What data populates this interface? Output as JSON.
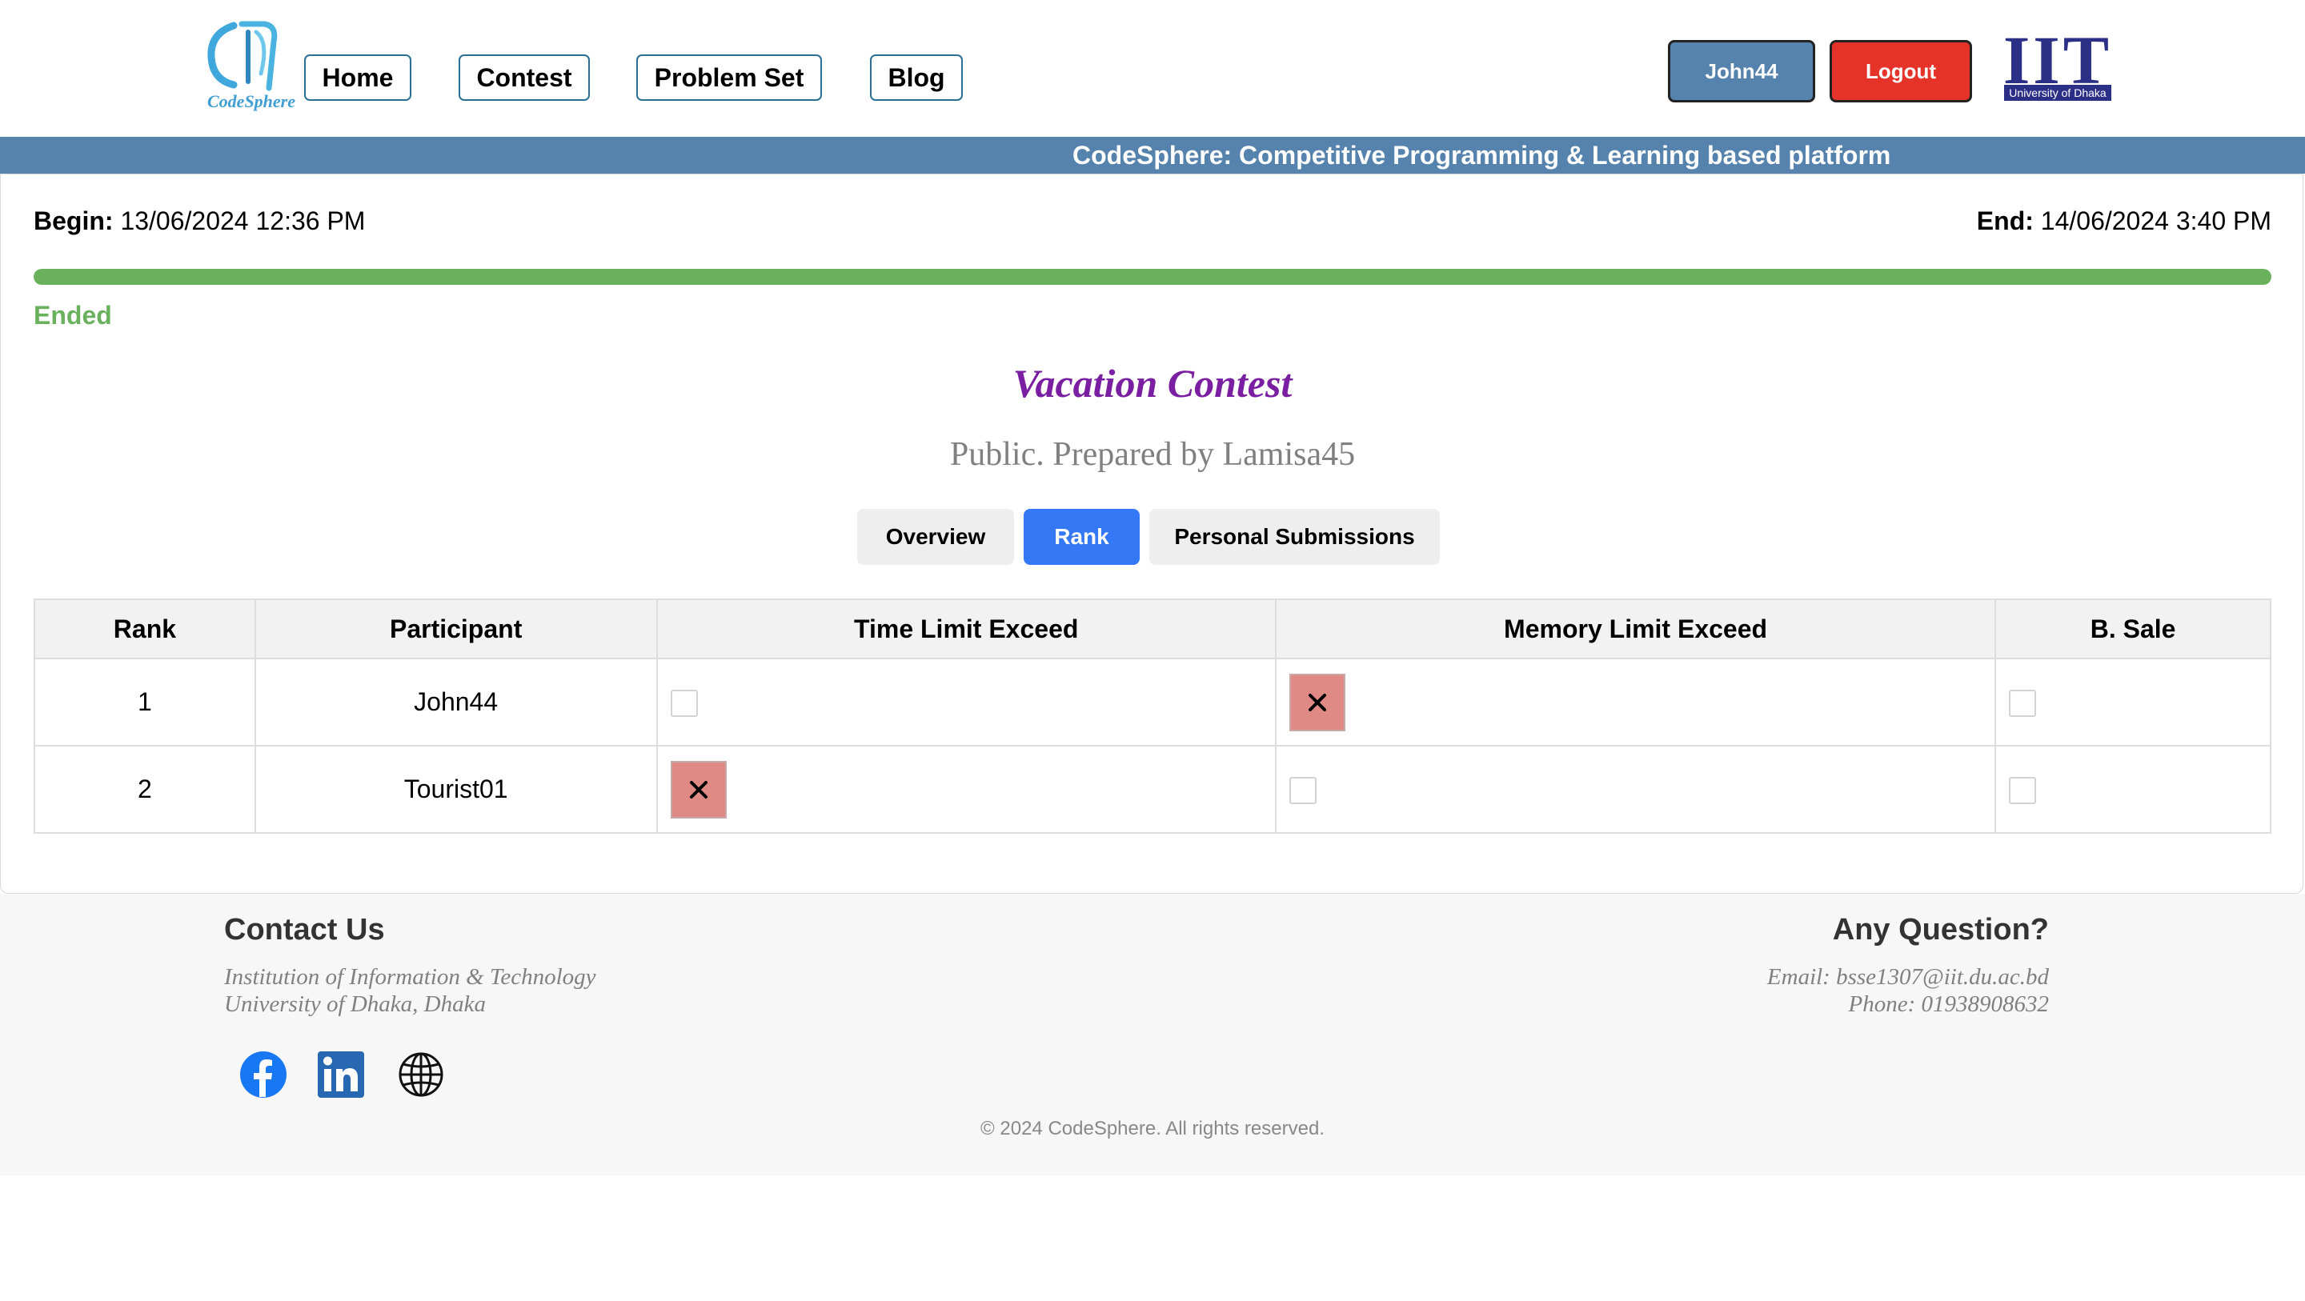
{
  "header": {
    "logo_text": "CodeSphere",
    "nav": [
      "Home",
      "Contest",
      "Problem Set",
      "Blog"
    ],
    "user_label": "John44",
    "logout_label": "Logout",
    "iit_title": "IIT",
    "iit_subtitle": "University of Dhaka"
  },
  "banner": "CodeSphere: Competitive Programming & Learning based platform",
  "contest": {
    "begin_label": "Begin:",
    "begin_value": "13/06/2024 12:36 PM",
    "end_label": "End:",
    "end_value": "14/06/2024 3:40 PM",
    "progress_percent": 100,
    "status": "Ended",
    "title": "Vacation Contest",
    "subtitle": "Public. Prepared by Lamisa45",
    "tabs": [
      "Overview",
      "Rank",
      "Personal Submissions"
    ],
    "active_tab": "Rank"
  },
  "rank_table": {
    "headers": [
      "Rank",
      "Participant",
      "Time Limit Exceed",
      "Memory Limit Exceed",
      "B. Sale"
    ],
    "rows": [
      {
        "rank": "1",
        "participant": "John44",
        "cells": [
          "empty",
          "failed",
          "empty"
        ]
      },
      {
        "rank": "2",
        "participant": "Tourist01",
        "cells": [
          "failed",
          "empty",
          "empty"
        ]
      }
    ]
  },
  "footer": {
    "contact_title": "Contact Us",
    "contact_line1": "Institution of Information & Technology",
    "contact_line2": "University of Dhaka, Dhaka",
    "question_title": "Any Question?",
    "email": "Email: bsse1307@iit.du.ac.bd",
    "phone": "Phone: 01938908632",
    "social_icons": [
      "facebook-icon",
      "linkedin-icon",
      "globe-icon"
    ],
    "copyright": "© 2024 CodeSphere. All rights reserved."
  },
  "colors": {
    "banner": "#5683ad",
    "progress": "#6ab15d",
    "title": "#7a1fa2",
    "active_tab": "#3478f6",
    "logout": "#e63329",
    "user_button": "#5683ad",
    "failed_cell": "#e08a86"
  }
}
